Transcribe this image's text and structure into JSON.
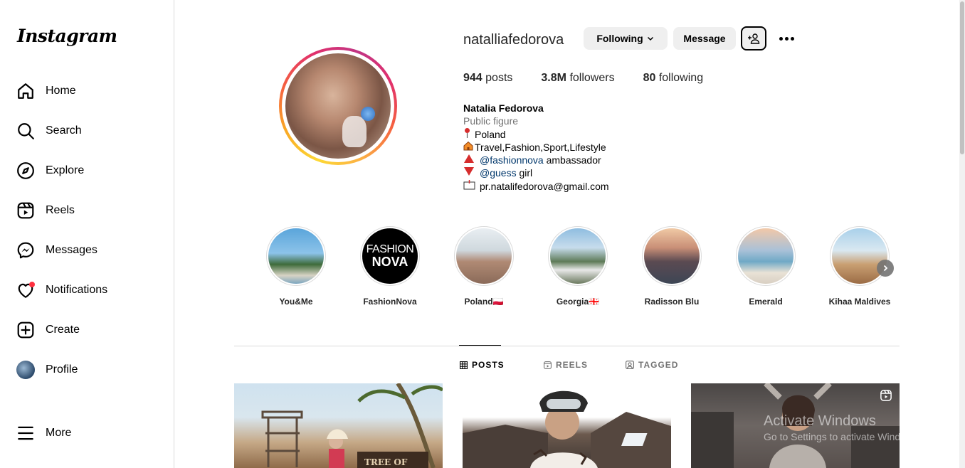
{
  "sidebar": {
    "logo": "Instagram",
    "items": [
      {
        "label": "Home",
        "icon": "home-icon"
      },
      {
        "label": "Search",
        "icon": "search-icon"
      },
      {
        "label": "Explore",
        "icon": "compass-icon"
      },
      {
        "label": "Reels",
        "icon": "reels-icon"
      },
      {
        "label": "Messages",
        "icon": "messenger-icon"
      },
      {
        "label": "Notifications",
        "icon": "heart-icon"
      },
      {
        "label": "Create",
        "icon": "plus-square-icon"
      },
      {
        "label": "Profile",
        "icon": "avatar"
      },
      {
        "label": "More",
        "icon": "hamburger-icon"
      }
    ]
  },
  "profile": {
    "username": "natalliafedorova",
    "following_button": "Following",
    "message_button": "Message",
    "stats": {
      "posts_count": "944",
      "posts_label": "posts",
      "followers_count": "3.8M",
      "followers_label": "followers",
      "following_count": "80",
      "following_label": "following"
    },
    "bio": {
      "name": "Natalia Fedorova",
      "category": "Public figure",
      "location": "Poland",
      "interests": "Travel,Fashion,Sport,Lifestyle",
      "line3_tag": "@fashionnova",
      "line3_rest": " ambassador",
      "line4_tag": "@guess",
      "line4_rest": " girl",
      "email": "pr.natalifedorova@gmail.com"
    }
  },
  "highlights": [
    {
      "label": "You&Me"
    },
    {
      "label": "FashionNova",
      "logo_line1": "FASHION",
      "logo_line2": "NOVA"
    },
    {
      "label": "Poland🇵🇱"
    },
    {
      "label": "Georgia🇬🇪"
    },
    {
      "label": "Radisson Blu"
    },
    {
      "label": "Emerald"
    },
    {
      "label": "Kihaa Maldives"
    }
  ],
  "tabs": [
    {
      "label": "POSTS",
      "icon": "grid-icon",
      "active": true
    },
    {
      "label": "REELS",
      "icon": "reels-icon"
    },
    {
      "label": "TAGGED",
      "icon": "tagged-icon"
    }
  ],
  "post1_sign": "TREE OF",
  "watermark": {
    "title": "Activate Windows",
    "subtitle": "Go to Settings to activate Windows."
  },
  "colors": {
    "notification_dot": "#ff3040",
    "link": "#00376b",
    "secondary_text": "#737373",
    "button_bg": "#efefef",
    "border": "#dbdbdb"
  }
}
